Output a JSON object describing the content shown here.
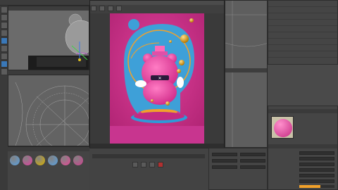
{
  "app": {
    "window_title": ""
  },
  "render_window": {
    "title": "",
    "status_text": ""
  },
  "viewports": {
    "left_label": "",
    "bottom_label": ""
  },
  "material_manager": {
    "menu": [
      "",
      "",
      "",
      ""
    ],
    "materials": [
      {
        "color": "#5aa0e0"
      },
      {
        "color": "#e040a0"
      },
      {
        "color": "#d8b000"
      },
      {
        "color": "#5aa0e0"
      },
      {
        "color": "#e84898"
      },
      {
        "color": "#d04090"
      }
    ]
  },
  "object_manager": {
    "items": [
      "",
      "",
      "",
      "",
      "",
      "",
      "",
      "",
      ""
    ]
  },
  "attributes": {
    "title": "",
    "material_name": "",
    "fields": [
      "",
      "",
      "",
      "",
      "",
      ""
    ]
  },
  "coordinates": {
    "fields": [
      "",
      "",
      "",
      "",
      "",
      ""
    ]
  },
  "colors": {
    "accent": "#f2a12a",
    "scene_bg": "#d6318f",
    "scene_blue": "#3ea0d8"
  }
}
